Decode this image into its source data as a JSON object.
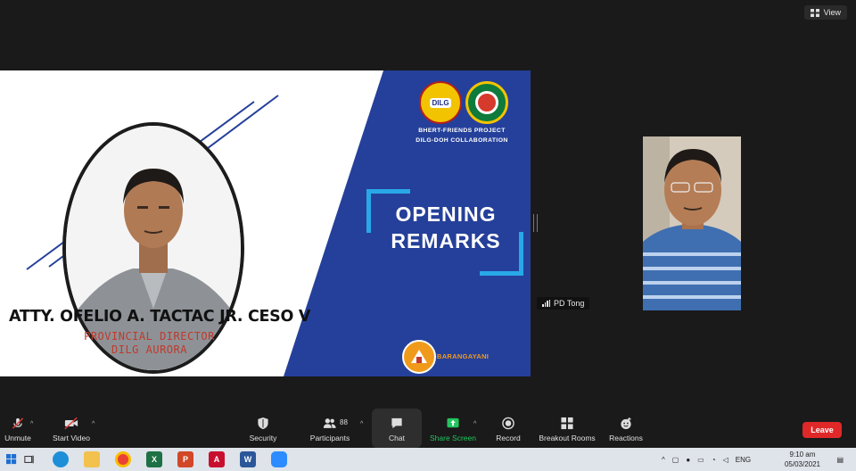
{
  "window": {
    "view_label": "View"
  },
  "slide": {
    "speaker_name": "ATTY. OFELIO A. TACTAC JR. CESO V",
    "speaker_role": "PROVINCIAL DIRECTOR",
    "speaker_office": "DILG AURORA",
    "logo_dilg_text": "DILG",
    "project_line1": "BHERT-FRIENDS PROJECT",
    "project_line2": "DILG-DOH COLLABORATION",
    "title_line1": "OPENING",
    "title_line2": "REMARKS",
    "barangay_text": "BARANGAYANI",
    "colors": {
      "blue": "#25409a",
      "accent": "#29a8e8",
      "role_red": "#c0392b",
      "orange": "#f09a1c"
    }
  },
  "participant": {
    "name": "PD Tong"
  },
  "toolbar": {
    "unmute_label": "Unmute",
    "start_video_label": "Start Video",
    "security_label": "Security",
    "participants_label": "Participants",
    "participants_count": "88",
    "chat_label": "Chat",
    "share_label": "Share Screen",
    "record_label": "Record",
    "breakout_label": "Breakout Rooms",
    "reactions_label": "Reactions",
    "leave_label": "Leave"
  },
  "taskbar": {
    "apps": [
      "windows-icon",
      "task-view-icon",
      "edge-icon",
      "file-explorer-icon",
      "chrome-icon",
      "excel-icon",
      "powerpoint-icon",
      "acrobat-icon",
      "word-icon",
      "zoom-icon"
    ],
    "language": "ENG",
    "time": "9:10 am",
    "date": "05/03/2021"
  }
}
